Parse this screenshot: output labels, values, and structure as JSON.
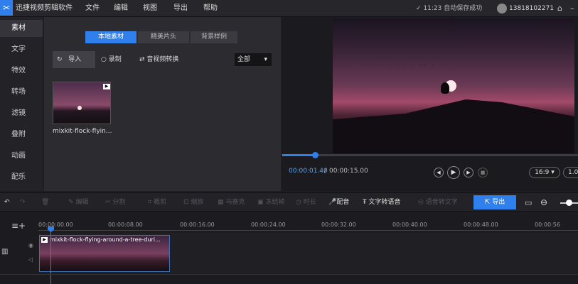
{
  "app": {
    "title": "迅捷视频剪辑软件"
  },
  "menu": [
    "文件",
    "编辑",
    "视图",
    "导出",
    "帮助"
  ],
  "header": {
    "save_status": "11:23 自动保存成功",
    "phone": "13818102271"
  },
  "sidebar": {
    "items": [
      "素材",
      "文字",
      "特效",
      "转场",
      "滤镜",
      "叠附",
      "动画",
      "配乐"
    ]
  },
  "media": {
    "tabs": [
      "本地素材",
      "精美片头",
      "背景样例"
    ],
    "import_label": "导入",
    "record_label": "录制",
    "convert_label": "音视频转换",
    "filter_value": "全部",
    "thumb_name": "mixkit-flock-flyin..."
  },
  "preview": {
    "time_current": "00:00:01.40",
    "time_separator": "/",
    "time_total": "00:00:15.00",
    "aspect_ratio": "16:9",
    "zoom": "1.0",
    "progress": 0.11
  },
  "toolbar": {
    "edit": "编辑",
    "split": "分割",
    "crop": "裁剪",
    "scale": "缩放",
    "mosaic": "马赛克",
    "freeze": "冻结帧",
    "duration": "时长",
    "dub": "配音",
    "tts": "文字转语音",
    "stt": "语音转文字",
    "export": "导出"
  },
  "timeline": {
    "ticks": [
      "00:00:00.00",
      "00:00:08.00",
      "00:00:16.00",
      "00:00:24.00",
      "00:00:32.00",
      "00:00:40.00",
      "00:00:48.00",
      "00:00:56"
    ],
    "clip_name": "mixkit-flock-flying-around-a-tree-duri..."
  },
  "colors": {
    "accent": "#2f80ed",
    "background": "#1e1e22"
  }
}
